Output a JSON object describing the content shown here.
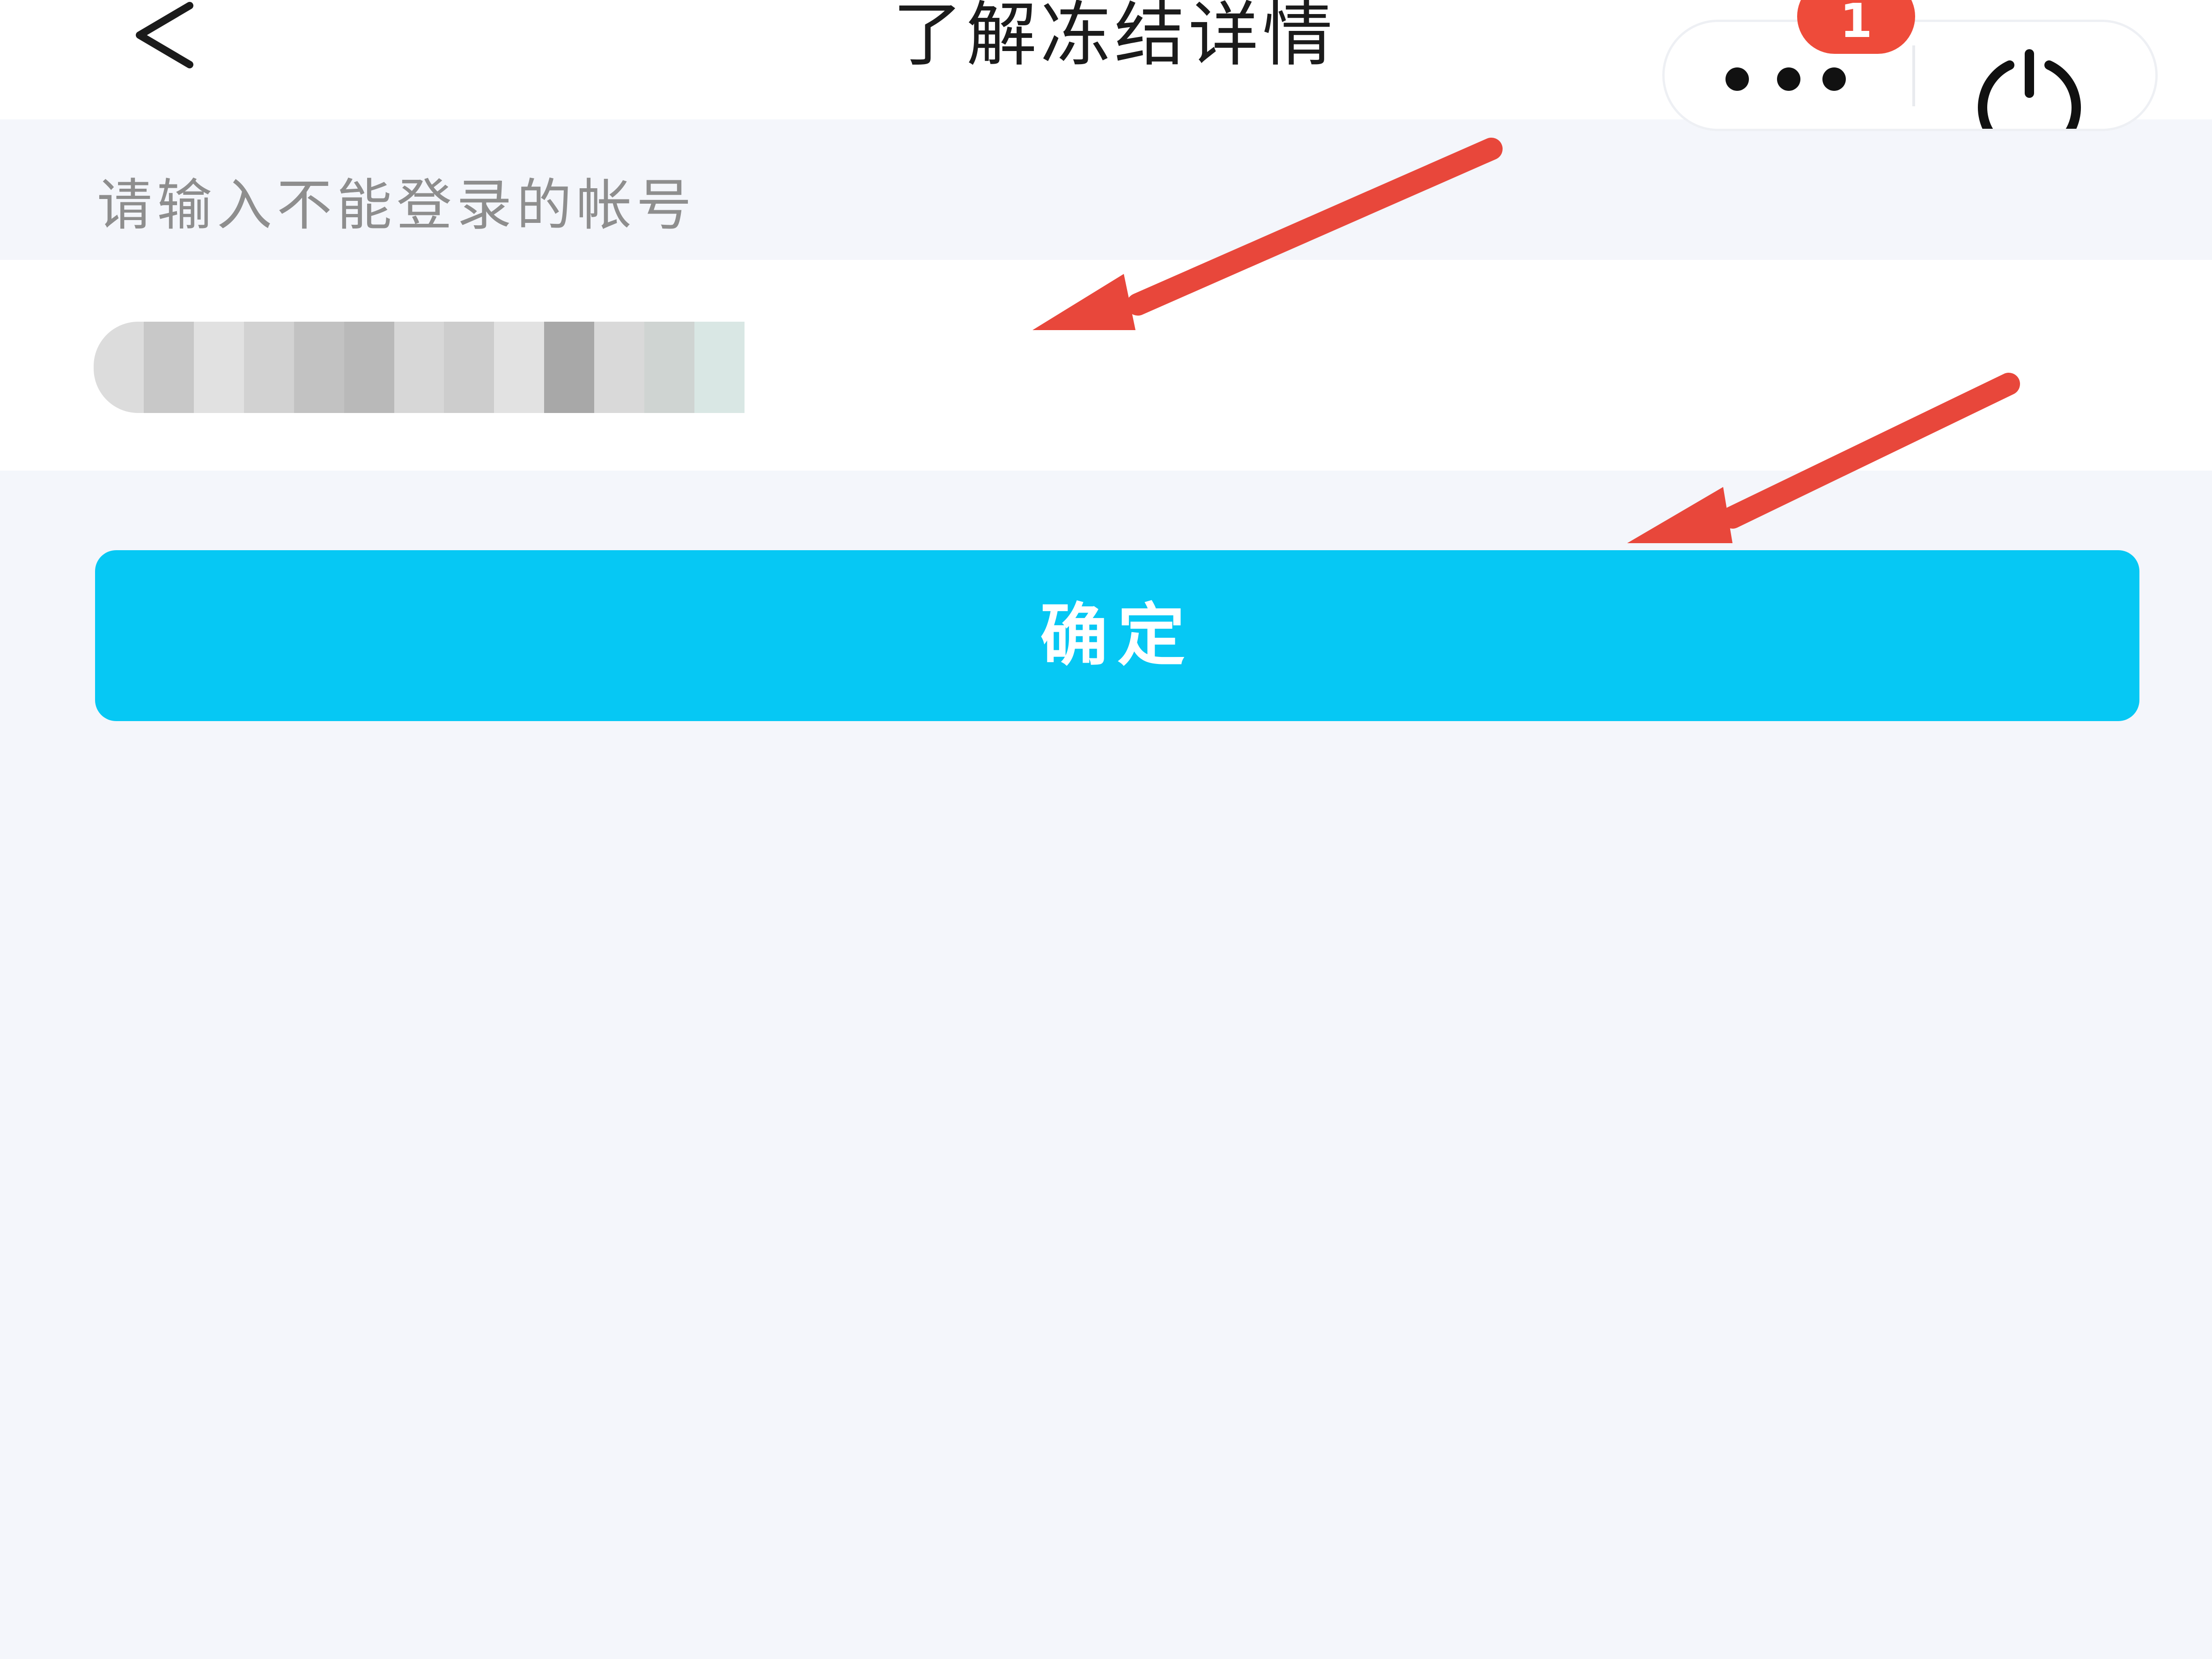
{
  "header": {
    "title": "了解冻结详情",
    "back_icon": "chevron-left-icon",
    "more_icon": "more-dots-icon",
    "power_icon": "power-icon",
    "badge_count": "1"
  },
  "form": {
    "hint": "请输入不能登录的帐号",
    "account_value_state": "obscured"
  },
  "actions": {
    "confirm_label": "确定"
  },
  "annotations": {
    "arrows": 2,
    "arrow_color": "#e8473b"
  },
  "colors": {
    "background": "#f4f6fb",
    "primary": "#06c8f4",
    "badge": "#ee4b3a",
    "title": "#1b1b1b",
    "hint": "#8e8e8e"
  }
}
